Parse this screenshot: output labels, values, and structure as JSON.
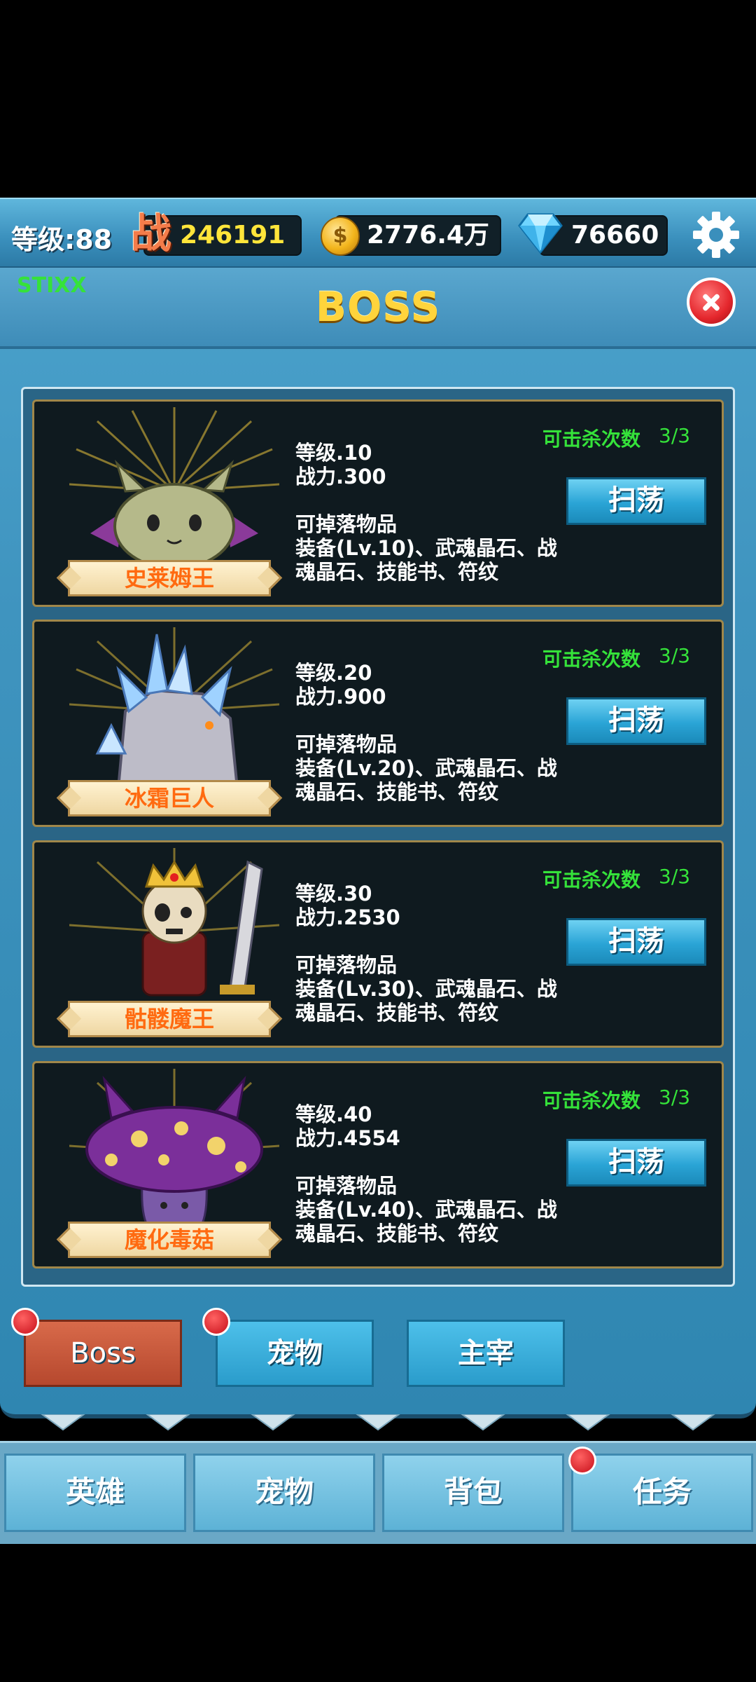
{
  "status": {
    "level_label": "等级:88",
    "power_icon_text": "战",
    "power_value": "246191",
    "gold_icon_text": "$",
    "gold_value": "2776.4万",
    "diamond_value": "76660"
  },
  "header": {
    "tag": "STIXX",
    "title": "BOSS"
  },
  "bosses": [
    {
      "name": "史莱姆王",
      "level": "等级.10",
      "power": "战力.300",
      "drops_label": "可掉落物品",
      "drops_line1": "装备(Lv.10)、武魂晶石、战",
      "drops_line2": "魂晶石、技能书、符纹",
      "kill_label": "可击杀次数",
      "kill_count": "3/3",
      "sweep_label": "扫荡"
    },
    {
      "name": "冰霜巨人",
      "level": "等级.20",
      "power": "战力.900",
      "drops_label": "可掉落物品",
      "drops_line1": "装备(Lv.20)、武魂晶石、战",
      "drops_line2": "魂晶石、技能书、符纹",
      "kill_label": "可击杀次数",
      "kill_count": "3/3",
      "sweep_label": "扫荡"
    },
    {
      "name": "骷髅魔王",
      "level": "等级.30",
      "power": "战力.2530",
      "drops_label": "可掉落物品",
      "drops_line1": "装备(Lv.30)、武魂晶石、战",
      "drops_line2": "魂晶石、技能书、符纹",
      "kill_label": "可击杀次数",
      "kill_count": "3/3",
      "sweep_label": "扫荡"
    },
    {
      "name": "魔化毒菇",
      "level": "等级.40",
      "power": "战力.4554",
      "drops_label": "可掉落物品",
      "drops_line1": "装备(Lv.40)、武魂晶石、战",
      "drops_line2": "魂晶石、技能书、符纹",
      "kill_label": "可击杀次数",
      "kill_count": "3/3",
      "sweep_label": "扫荡"
    }
  ],
  "tabs": [
    "Boss",
    "宠物",
    "主宰"
  ],
  "nav": [
    "英雄",
    "宠物",
    "背包",
    "任务"
  ],
  "colors": {
    "accent_green": "#35e23a",
    "title_gold": "#ffd43c",
    "name_orange": "#ff6a10",
    "panel_blue": "#3f94bf"
  }
}
